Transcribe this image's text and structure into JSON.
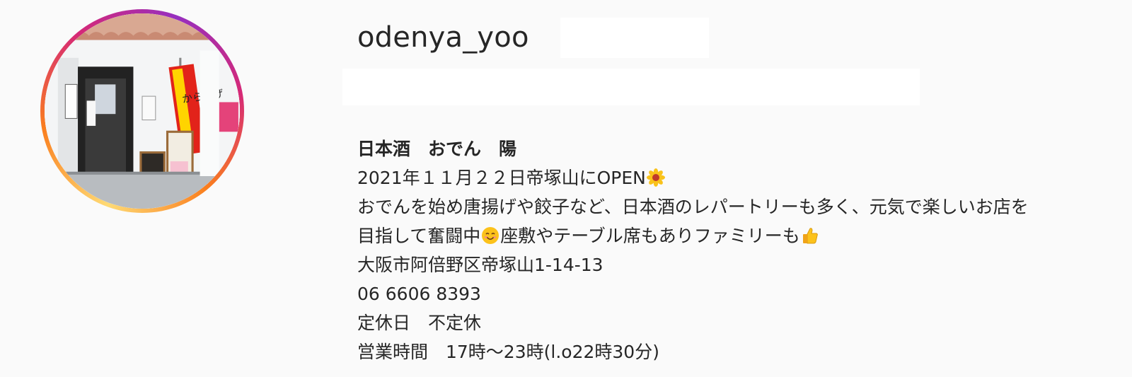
{
  "profile": {
    "username": "odenya_yoo"
  },
  "bio": {
    "name": "日本酒　おでん　陽",
    "line1": "2021年１１月２２日帝塚山にOPEN",
    "line2": "おでんを始め唐揚げや餃子など、日本酒のレパートリーも多く、元気で楽しいお店を",
    "line3a": "目指して奮闘中",
    "line3b": "座敷やテーブル席もありファミリーも",
    "address": "大阪市阿倍野区帝塚山1-14-13",
    "phone": "06 6606 8393",
    "holiday": "定休日　不定休",
    "hours": "営業時間　17時〜23時(l.o22時30分)"
  },
  "avatar": {
    "sign_main": "からあげ",
    "sign_top": "持ち帰り"
  },
  "colors": {
    "text": "#262626",
    "background": "#fafafa",
    "ring_start": "#feda75",
    "ring_mid": "#d62976",
    "ring_end": "#962fbf"
  },
  "icons": {
    "flower": "sunflower-emoji-icon",
    "smile": "smiling-face-emoji-icon",
    "thumbs": "thumbs-up-emoji-icon"
  }
}
